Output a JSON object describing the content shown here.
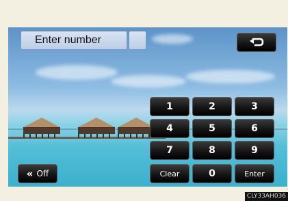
{
  "input": {
    "label": "Enter number"
  },
  "keypad": {
    "k1": "1",
    "k2": "2",
    "k3": "3",
    "k4": "4",
    "k5": "5",
    "k6": "6",
    "k7": "7",
    "k8": "8",
    "k9": "9",
    "clear": "Clear",
    "k0": "0",
    "enter": "Enter"
  },
  "off_button": {
    "chevrons": "«",
    "label": "Off"
  },
  "back_button": {
    "icon": "back-arrow-icon"
  },
  "caption": "CLY33AH036",
  "colors": {
    "button_bg": "#111111",
    "field_bg": "#c9d7ec",
    "frame_bg": "#f3f0e2"
  }
}
